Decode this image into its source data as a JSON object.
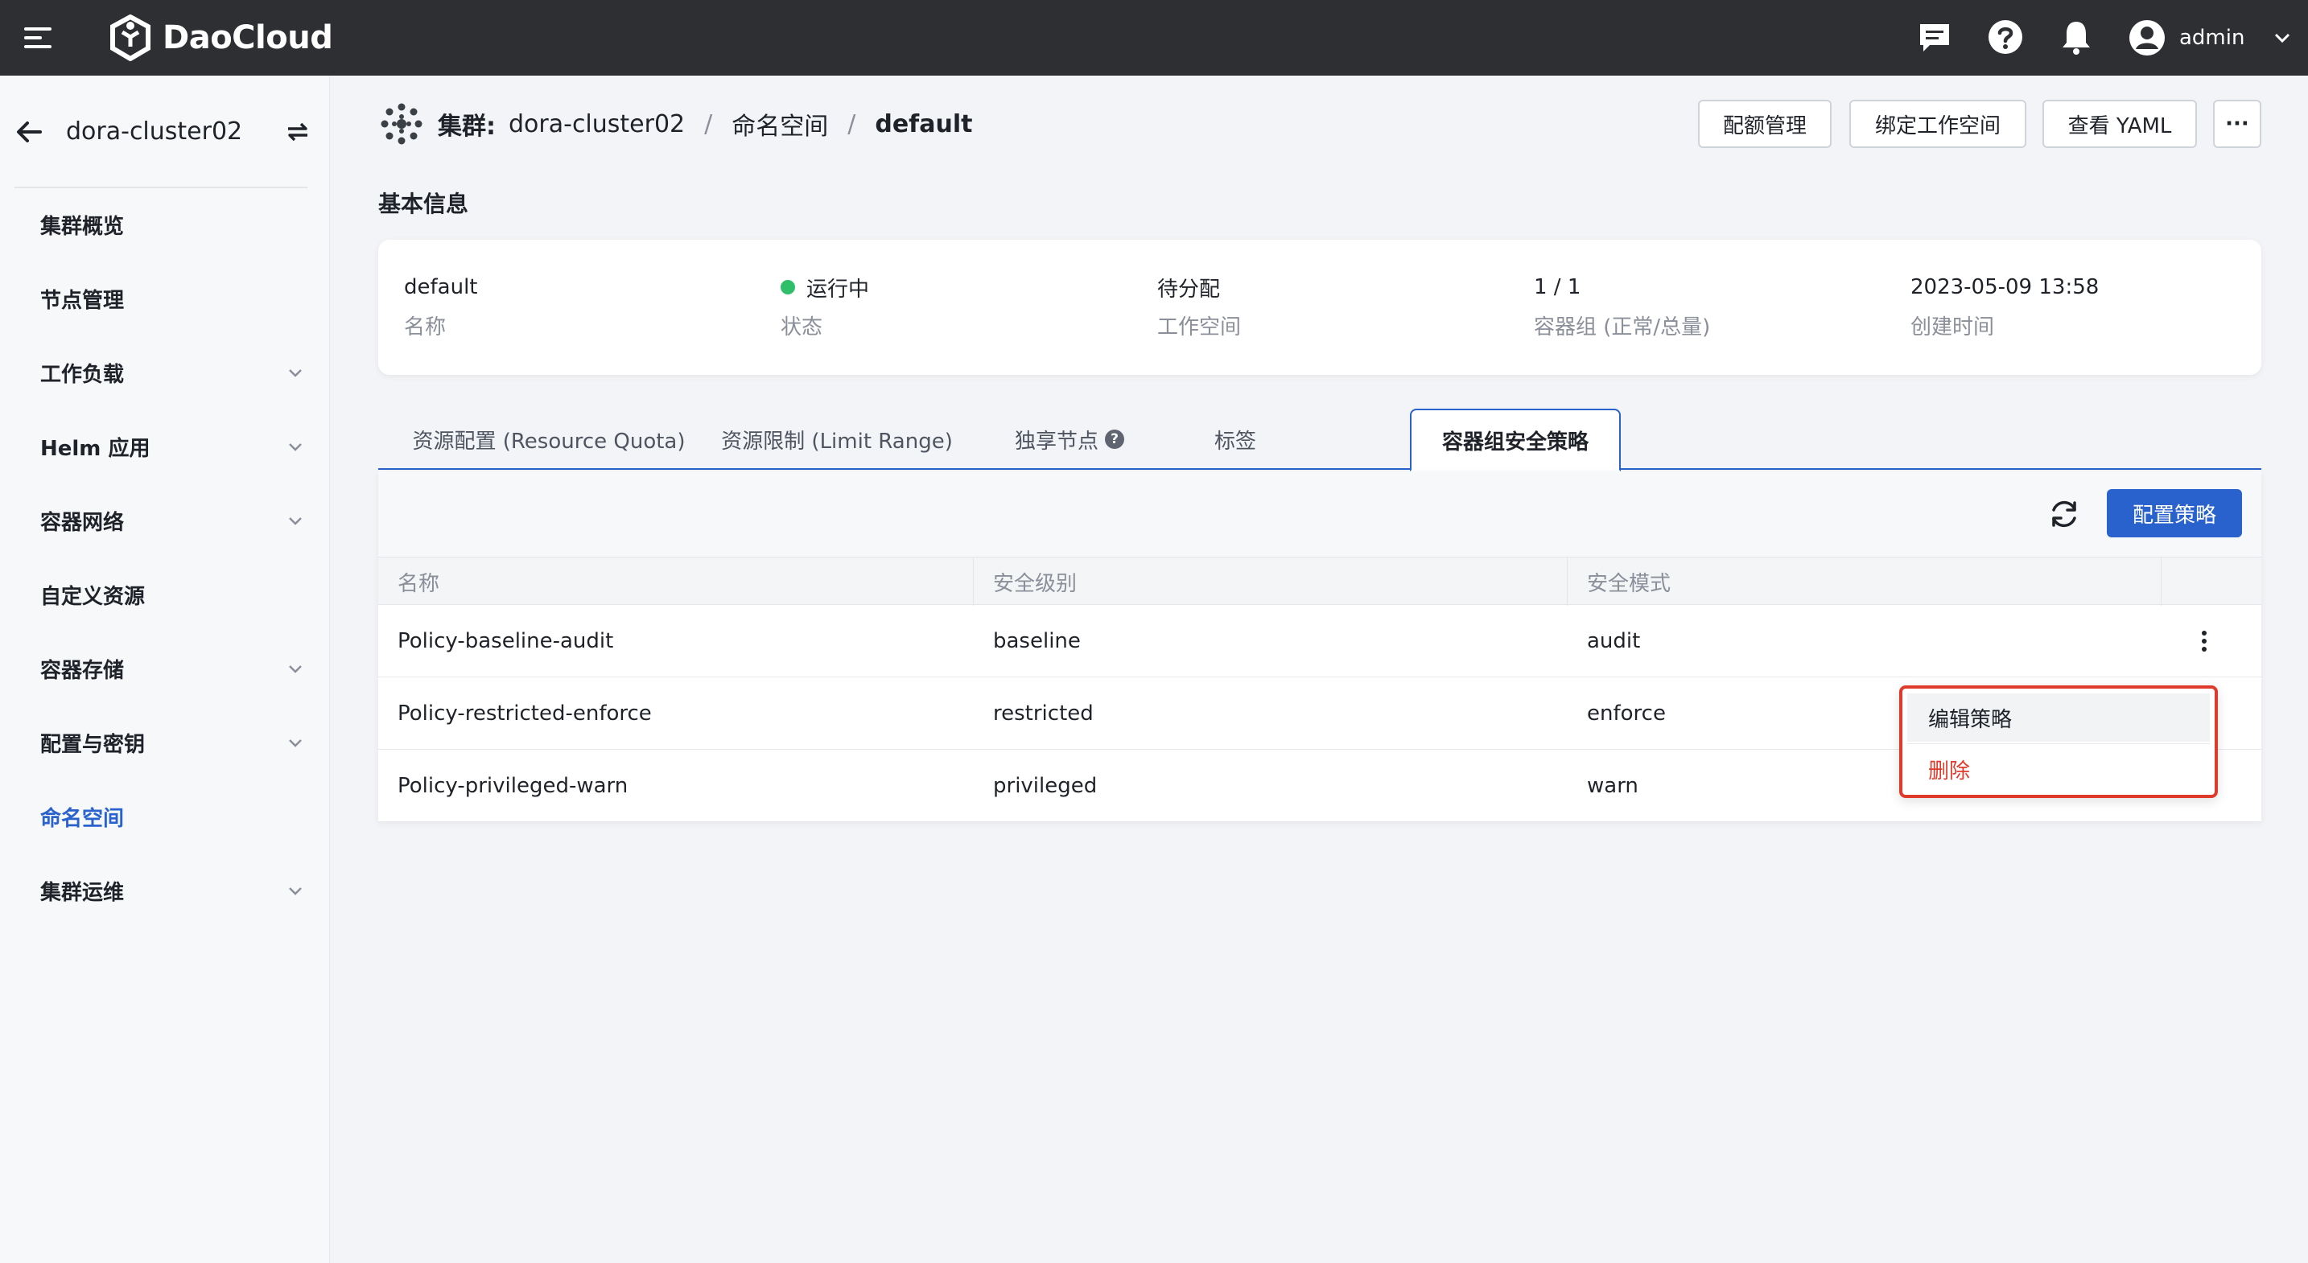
{
  "topbar": {
    "brand": "DaoCloud",
    "user_name": "admin",
    "icons": [
      "menu-icon",
      "message-icon",
      "help-icon",
      "bell-icon",
      "user-avatar-icon",
      "chevron-down-icon"
    ]
  },
  "sidebar": {
    "cluster_name": "dora-cluster02",
    "items": [
      {
        "label": "集群概览",
        "expandable": false
      },
      {
        "label": "节点管理",
        "expandable": false
      },
      {
        "label": "工作负载",
        "expandable": true
      },
      {
        "label": "Helm 应用",
        "expandable": true
      },
      {
        "label": "容器网络",
        "expandable": true
      },
      {
        "label": "自定义资源",
        "expandable": false
      },
      {
        "label": "容器存储",
        "expandable": true
      },
      {
        "label": "配置与密钥",
        "expandable": true
      },
      {
        "label": "命名空间",
        "expandable": false,
        "active": true
      },
      {
        "label": "集群运维",
        "expandable": true
      }
    ]
  },
  "breadcrumb": {
    "prefix": "集群:",
    "cluster": "dora-cluster02",
    "separator": "/",
    "namespace_label": "命名空间",
    "current": "default"
  },
  "actions": {
    "quota": "配额管理",
    "bind_workspace": "绑定工作空间",
    "view_yaml": "查看 YAML",
    "more": "···"
  },
  "basic_info": {
    "title": "基本信息",
    "fields": [
      {
        "value": "default",
        "label": "名称"
      },
      {
        "value": "运行中",
        "label": "状态"
      },
      {
        "value": "待分配",
        "label": "工作空间"
      },
      {
        "value": "1 / 1",
        "label": "容器组 (正常/总量)"
      },
      {
        "value": "2023-05-09 13:58",
        "label": "创建时间"
      }
    ],
    "status_color": "#2fbf6a"
  },
  "tabs": [
    {
      "label": "资源配置 (Resource Quota)"
    },
    {
      "label": "资源限制 (Limit Range)"
    },
    {
      "label": "独享节点"
    },
    {
      "label": "标签"
    },
    {
      "label": "容器组安全策略",
      "active": true
    }
  ],
  "tab_help": "?",
  "table": {
    "toolbar_button": "配置策略",
    "columns": [
      "名称",
      "安全级别",
      "安全模式"
    ],
    "rows": [
      [
        "Policy-baseline-audit",
        "baseline",
        "audit"
      ],
      [
        "Policy-restricted-enforce",
        "restricted",
        "enforce"
      ],
      [
        "Policy-privileged-warn",
        "privileged",
        "warn"
      ]
    ]
  },
  "context_menu": {
    "edit": "编辑策略",
    "delete": "删除"
  },
  "colors": {
    "accent": "#2962cc",
    "danger": "#e03a2a",
    "topbar": "#2d2f33"
  }
}
